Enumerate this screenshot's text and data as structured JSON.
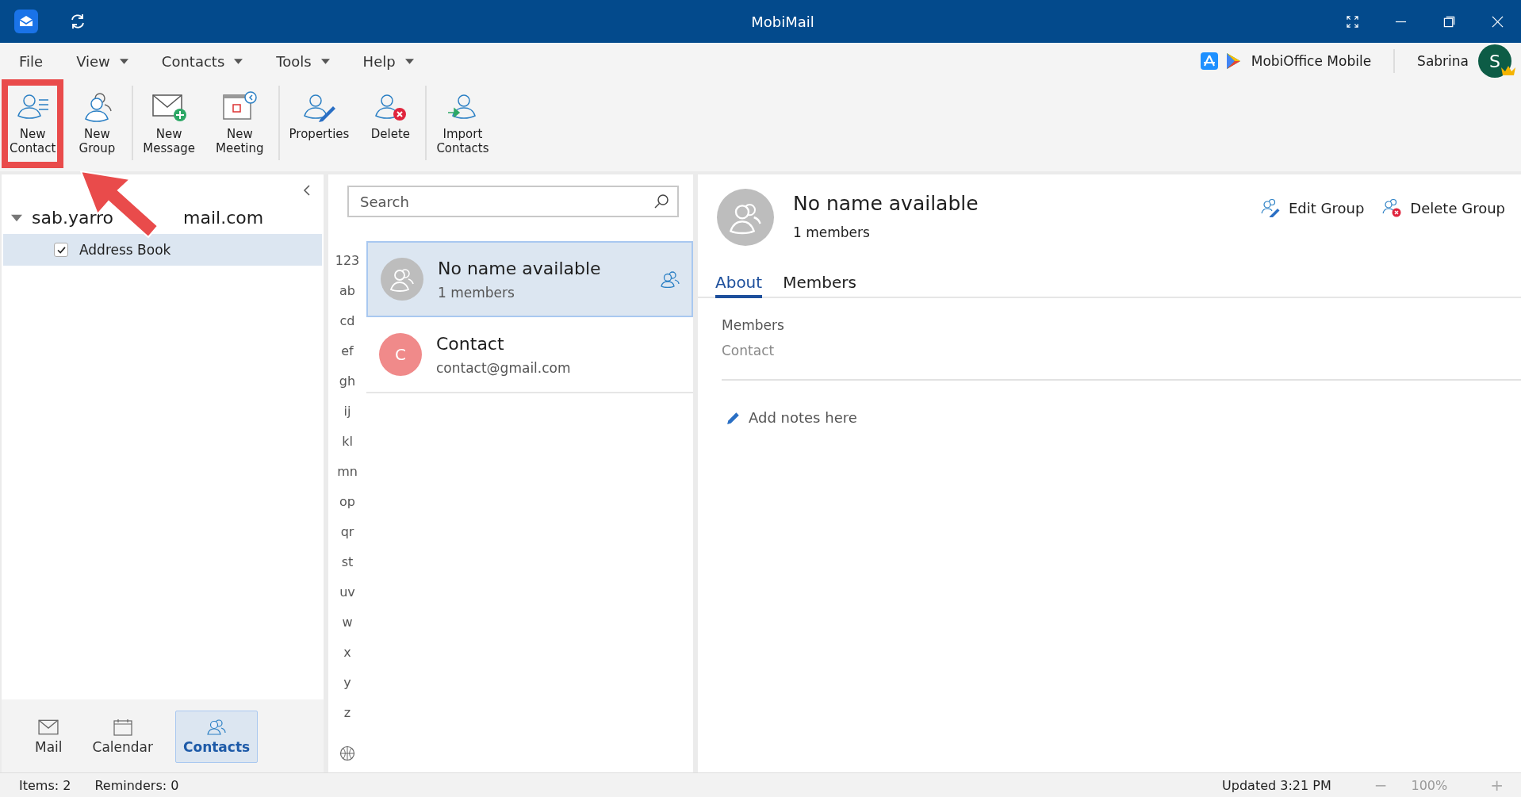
{
  "window": {
    "title": "MobiMail"
  },
  "menu": [
    {
      "label": "File",
      "has_dropdown": false
    },
    {
      "label": "View",
      "has_dropdown": true
    },
    {
      "label": "Contacts",
      "has_dropdown": true
    },
    {
      "label": "Tools",
      "has_dropdown": true
    },
    {
      "label": "Help",
      "has_dropdown": true
    }
  ],
  "promo": {
    "label": "MobiOffice Mobile"
  },
  "user": {
    "name": "Sabrina",
    "initial": "S",
    "premium": true
  },
  "toolbar": [
    [
      {
        "kind": "new-contact",
        "label": "New Contact",
        "highlighted": true
      },
      {
        "kind": "new-group",
        "label": "New Group",
        "highlighted": false
      }
    ],
    [
      {
        "kind": "new-message",
        "label": "New Message",
        "highlighted": false
      },
      {
        "kind": "new-meeting",
        "label": "New Meeting",
        "highlighted": false
      }
    ],
    [
      {
        "kind": "properties",
        "label": "Properties",
        "highlighted": false
      },
      {
        "kind": "delete",
        "label": "Delete",
        "highlighted": false
      }
    ],
    [
      {
        "kind": "import",
        "label": "Import Contacts",
        "highlighted": false
      }
    ]
  ],
  "sidebar": {
    "account": {
      "parts": [
        "sab.yarro",
        "mail.com"
      ],
      "expanded": true
    },
    "folders": [
      {
        "label": "Address Book",
        "checked": true,
        "selected": true
      }
    ]
  },
  "nav": [
    {
      "kind": "mail",
      "label": "Mail",
      "selected": false
    },
    {
      "kind": "calendar",
      "label": "Calendar",
      "selected": false
    },
    {
      "kind": "contacts",
      "label": "Contacts",
      "selected": true
    }
  ],
  "search": {
    "placeholder": "Search"
  },
  "alphabet": [
    "123",
    "ab",
    "cd",
    "ef",
    "gh",
    "ij",
    "kl",
    "mn",
    "op",
    "qr",
    "st",
    "uv",
    "w",
    "x",
    "y",
    "z"
  ],
  "contacts": [
    {
      "kind": "group",
      "name": "No name available",
      "detail": "1 members",
      "selected": true
    },
    {
      "kind": "person",
      "name": "Contact",
      "detail": "contact@gmail.com",
      "initial": "C",
      "color": "#f08a8a",
      "selected": false
    }
  ],
  "detail": {
    "name": "No name available",
    "subtitle": "1 members",
    "actions": [
      {
        "kind": "edit",
        "label": "Edit Group"
      },
      {
        "kind": "delete",
        "label": "Delete Group"
      }
    ],
    "tabs": [
      {
        "label": "About",
        "selected": true
      },
      {
        "label": "Members",
        "selected": false
      }
    ],
    "section_label": "Members",
    "members": [
      "Contact"
    ],
    "notes_placeholder": "Add notes here"
  },
  "status_bar": {
    "items": "Items: 2",
    "reminders": "Reminders: 0",
    "updated": "Updated 3:21 PM",
    "zoom_out": "−",
    "zoom": "100%",
    "zoom_in": "+"
  }
}
